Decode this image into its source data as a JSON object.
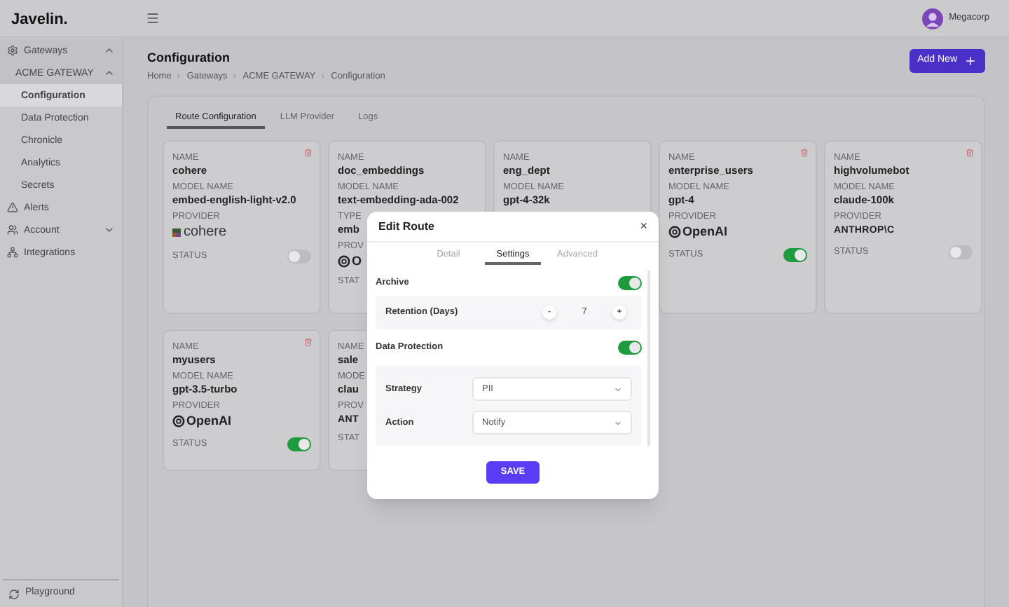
{
  "header": {
    "logo": "Javelin.",
    "user": "Megacorp"
  },
  "sidebar": {
    "items": [
      {
        "label": "Gateways",
        "expanded": true,
        "selected": false,
        "children": [
          {
            "label": "ACME GATEWAY",
            "expanded": true,
            "selected": false,
            "children": [
              {
                "label": "Configuration",
                "selected": true
              },
              {
                "label": "Data Protection",
                "selected": false
              },
              {
                "label": "Chronicle",
                "selected": false
              },
              {
                "label": "Analytics",
                "selected": false
              },
              {
                "label": "Secrets",
                "selected": false
              }
            ]
          }
        ]
      },
      {
        "label": "Alerts",
        "selected": false
      },
      {
        "label": "Account",
        "expanded": false,
        "selected": false
      },
      {
        "label": "Integrations",
        "selected": false
      }
    ],
    "footer": "Playground"
  },
  "page": {
    "title": "Configuration",
    "breadcrumb": [
      "Home",
      "Gateways",
      "ACME GATEWAY",
      "Configuration"
    ],
    "add_button": "Add New"
  },
  "tabs": [
    {
      "label": "Route Configuration",
      "selected": true
    },
    {
      "label": "LLM Provider",
      "selected": false
    },
    {
      "label": "Logs",
      "selected": false
    }
  ],
  "cards": [
    {
      "fields": [
        {
          "label": "NAME",
          "value": "cohere"
        },
        {
          "label": "MODEL NAME",
          "value": "embed-english-light-v2.0"
        }
      ],
      "provider": {
        "label": "PROVIDER",
        "kind": "cohere",
        "name": "cohere"
      },
      "status": {
        "label": "STATUS",
        "on": false
      }
    },
    {
      "fields": [
        {
          "label": "NAME",
          "value": "doc_embeddings"
        },
        {
          "label": "MODEL NAME",
          "value": "text-embedding-ada-002"
        },
        {
          "label": "TYPE",
          "value": "emb"
        }
      ],
      "provider": {
        "label": "PROV",
        "kind": "openai",
        "name": "O"
      },
      "status": {
        "label": "STAT"
      }
    },
    {
      "fields": [
        {
          "label": "NAME",
          "value": "eng_dept"
        },
        {
          "label": "MODEL NAME",
          "value": "gpt-4-32k"
        }
      ]
    },
    {
      "fields": [
        {
          "label": "NAME",
          "value": "enterprise_users"
        },
        {
          "label": "MODEL NAME",
          "value": "gpt-4"
        }
      ],
      "provider": {
        "label": "PROVIDER",
        "kind": "openai",
        "name": "OpenAI"
      },
      "status": {
        "label": "STATUS",
        "on": true
      }
    },
    {
      "fields": [
        {
          "label": "NAME",
          "value": "highvolumebot"
        },
        {
          "label": "MODEL NAME",
          "value": "claude-100k"
        }
      ],
      "provider": {
        "label": "PROVIDER",
        "kind": "anthropic",
        "name": "ANTHROP\\C"
      },
      "status": {
        "label": "STATUS",
        "on": false
      }
    },
    {
      "fields": [
        {
          "label": "NAME",
          "value": "myusers"
        },
        {
          "label": "MODEL NAME",
          "value": "gpt-3.5-turbo"
        }
      ],
      "provider": {
        "label": "PROVIDER",
        "kind": "openai",
        "name": "OpenAI"
      },
      "status": {
        "label": "STATUS",
        "on": true
      }
    },
    {
      "fields": [
        {
          "label": "NAME",
          "value": "sale"
        },
        {
          "label": "MODE",
          "value": "clau"
        }
      ],
      "provider": {
        "label": "PROV",
        "kind": "anthropic",
        "name": "ANT"
      },
      "status": {
        "label": "STAT"
      }
    }
  ],
  "modal": {
    "title": "Edit Route",
    "close": "×",
    "tabs": [
      {
        "label": "Detail",
        "selected": false
      },
      {
        "label": "Settings",
        "selected": true
      },
      {
        "label": "Advanced",
        "selected": false
      }
    ],
    "archive": {
      "label": "Archive",
      "on": true
    },
    "retention": {
      "label": "Retention (Days)",
      "minus": "-",
      "value": "7",
      "plus": "+"
    },
    "data_protection": {
      "label": "Data Protection",
      "on": true
    },
    "selects": [
      {
        "label": "Strategy",
        "value": "PII"
      },
      {
        "label": "Action",
        "value": "Notify"
      }
    ],
    "save": "SAVE"
  }
}
